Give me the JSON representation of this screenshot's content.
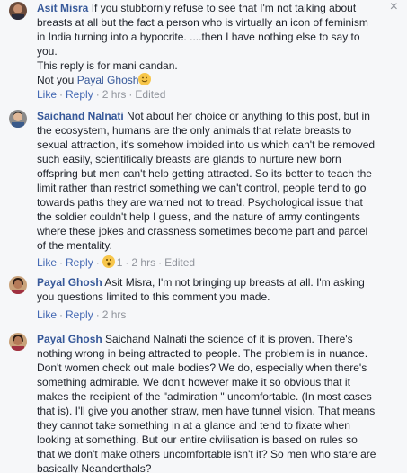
{
  "comments": [
    {
      "author": "Asit Misra",
      "lines_first": "If you stubbornly refuse to see that I'm not talking about",
      "lines": [
        "breasts at all but the fact a person who is virtually an icon of feminism",
        "in India turning into a hypocrite. ....then I have nothing else to say to",
        "you.",
        "This reply is for mani candan."
      ],
      "last_line_prefix": "Not you ",
      "mention": "Payal Ghosh",
      "like": "Like",
      "reply": "Reply",
      "time": "2 hrs",
      "edited": "Edited"
    },
    {
      "author": "Saichand Nalnati",
      "lines_first": "Not about her choice or anything to this post, but in",
      "lines": [
        "the ecosystem, humans are the only animals that relate breasts to",
        "sexual attraction, it's somehow imbided into us which can't be removed",
        "such easily, scientifically breasts are glands to nurture new born",
        "offspring but men can't help getting attracted. So its better to teach the",
        "limit rather than restrict something we can't control, people tend to go",
        "towards paths they are warned not to tread. Psychological issue that",
        "the soldier couldn't help I guess, and the nature of army contingents",
        "where these jokes and crassness sometimes become part and parcel",
        "of the mentality."
      ],
      "like": "Like",
      "reply": "Reply",
      "reaction_count": "1",
      "time": "2 hrs",
      "edited": "Edited"
    },
    {
      "author": "Payal Ghosh",
      "lines_first": "Asit Misra, I'm not bringing up breasts at all. I'm asking",
      "lines": [
        "you questions limited to this comment you made."
      ],
      "like": "Like",
      "reply": "Reply",
      "time": "2 hrs"
    },
    {
      "author": "Payal Ghosh",
      "lines_first": "Saichand Nalnati the science of it is proven. There's",
      "lines": [
        "nothing wrong in being attracted to people. The problem is in nuance.",
        "Don't women check out male bodies? We do, especially when there's",
        "something admirable. We don't however make it so obvious that it",
        "makes the recipient of the \"admiration \" uncomfortable. (In most cases",
        "that is). I'll give you another straw, men have tunnel vision. That means",
        "they cannot take something in at a glance and tend to fixate when",
        "looking at something. But our entire civilisation is based on rules so",
        "that we don't make others uncomfortable isn't it? So men who stare are",
        "basically Neanderthals?"
      ]
    }
  ],
  "close_label": "×",
  "middot": "·"
}
